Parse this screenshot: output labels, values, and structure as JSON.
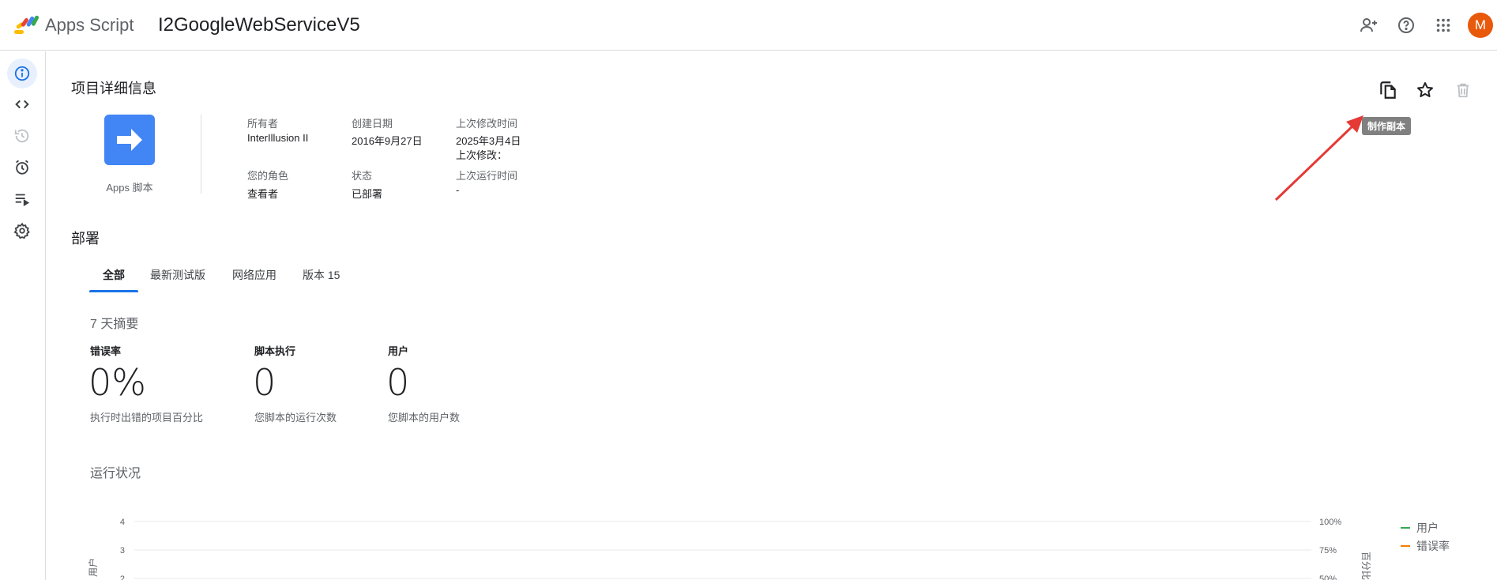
{
  "header": {
    "app_name": "Apps Script",
    "project_title": "I2GoogleWebServiceV5",
    "avatar_letter": "M",
    "icons": [
      "person-add-icon",
      "help-icon",
      "apps-grid-icon"
    ]
  },
  "sidebar": {
    "items": [
      {
        "name": "overview",
        "icon": "info-icon",
        "active": true
      },
      {
        "name": "editor",
        "icon": "code-icon"
      },
      {
        "name": "history",
        "icon": "history-icon"
      },
      {
        "name": "triggers",
        "icon": "alarm-icon"
      },
      {
        "name": "executions",
        "icon": "executions-icon"
      },
      {
        "name": "settings",
        "icon": "gear-icon"
      }
    ]
  },
  "details": {
    "title": "项目详细信息",
    "card_label": "Apps 脚本",
    "owner_label": "所有者",
    "owner_value": "InterIllusion II",
    "created_label": "创建日期",
    "created_value": "2016年9月27日",
    "modified_label": "上次修改时间",
    "modified_value": "2025年3月4日",
    "modified_by": "上次修改：",
    "role_label": "您的角色",
    "role_value": "查看者",
    "status_label": "状态",
    "status_value": "已部署",
    "last_run_label": "上次运行时间",
    "last_run_value": "-"
  },
  "actions": {
    "tooltip": "制作副本",
    "icons": [
      "copy-icon",
      "star-icon",
      "trash-icon"
    ],
    "annotation_color": "#e53935"
  },
  "deployments": {
    "title": "部署",
    "tabs": [
      "全部",
      "最新测试版",
      "网络应用",
      "版本 15"
    ],
    "active_tab": 0
  },
  "summary": {
    "title": "7 天摘要",
    "stats": [
      {
        "label": "错误率",
        "value": "0%",
        "desc": "执行时出错的项目百分比"
      },
      {
        "label": "脚本执行",
        "value": "0",
        "desc": "您脚本的运行次数"
      },
      {
        "label": "用户",
        "value": "0",
        "desc": "您脚本的用户数"
      }
    ]
  },
  "health": {
    "title": "运行状况"
  },
  "chart_data": {
    "type": "line",
    "title": "",
    "ylabel": "用户",
    "y2label": "百分比",
    "y_ticks": [
      "4",
      "3",
      "2"
    ],
    "y2_ticks": [
      "100%",
      "75%",
      "50%"
    ],
    "ylim": [
      0,
      4
    ],
    "y2lim": [
      0,
      100
    ],
    "grid": true,
    "legend_placement": "right",
    "series": [
      {
        "name": "用户",
        "color": "#34a853",
        "values": []
      },
      {
        "name": "错误率",
        "color": "#f57c00",
        "values": []
      }
    ]
  }
}
